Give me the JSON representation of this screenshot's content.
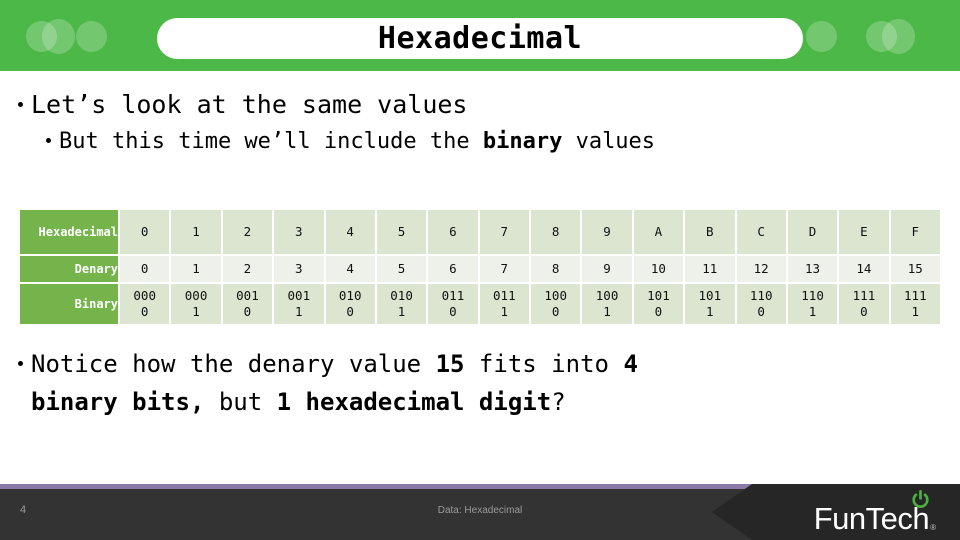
{
  "slide": {
    "title": "Hexadecimal",
    "page_number": "4",
    "footer_center": "Data: Hexadecimal",
    "brand": "FunTech",
    "brand_registered": "®",
    "colors": {
      "header_green": "#4cb847",
      "label_green": "#74b44a",
      "row_shade": "#dbe5d0",
      "row_light": "#eef1ea",
      "footer_dark": "#333333",
      "footer_stripe": "#8b7aa8",
      "logo_green": "#4caf3e"
    }
  },
  "bullets_top": [
    {
      "level": 1,
      "text": "Let’s look at the same values"
    },
    {
      "level": 2,
      "parts": [
        {
          "text": "But this time we’ll include the ",
          "bold": false
        },
        {
          "text": "binary",
          "bold": true
        },
        {
          "text": " values",
          "bold": false
        }
      ]
    }
  ],
  "bullet_bottom": {
    "line1": [
      {
        "text": "Notice how the denary value ",
        "bold": false
      },
      {
        "text": "15",
        "bold": true
      },
      {
        "text": " fits into ",
        "bold": false
      },
      {
        "text": "4",
        "bold": true
      }
    ],
    "line2": [
      {
        "text": "binary bits,",
        "bold": true
      },
      {
        "text": " but ",
        "bold": false
      },
      {
        "text": "1 hexadecimal digit",
        "bold": true
      },
      {
        "text": "?",
        "bold": false
      }
    ]
  },
  "table": {
    "row_labels": [
      "Hexadecimal",
      "Denary",
      "Binary"
    ],
    "hexadecimal": [
      "0",
      "1",
      "2",
      "3",
      "4",
      "5",
      "6",
      "7",
      "8",
      "9",
      "A",
      "B",
      "C",
      "D",
      "E",
      "F"
    ],
    "denary": [
      "0",
      "1",
      "2",
      "3",
      "4",
      "5",
      "6",
      "7",
      "8",
      "9",
      "10",
      "11",
      "12",
      "13",
      "14",
      "15"
    ],
    "binary": [
      [
        "000",
        "0"
      ],
      [
        "000",
        "1"
      ],
      [
        "001",
        "0"
      ],
      [
        "001",
        "1"
      ],
      [
        "010",
        "0"
      ],
      [
        "010",
        "1"
      ],
      [
        "011",
        "0"
      ],
      [
        "011",
        "1"
      ],
      [
        "100",
        "0"
      ],
      [
        "100",
        "1"
      ],
      [
        "101",
        "0"
      ],
      [
        "101",
        "1"
      ],
      [
        "110",
        "0"
      ],
      [
        "110",
        "1"
      ],
      [
        "111",
        "0"
      ],
      [
        "111",
        "1"
      ]
    ]
  }
}
